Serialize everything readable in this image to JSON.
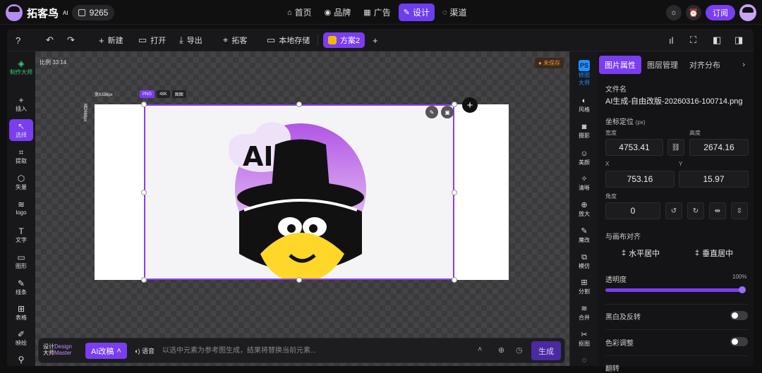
{
  "app": {
    "name": "拓客鸟",
    "name_suffix": "AI",
    "credits": "9265"
  },
  "nav": [
    {
      "label": "首页",
      "icon": "⌂"
    },
    {
      "label": "品牌",
      "icon": "◉"
    },
    {
      "label": "广告",
      "icon": "▦"
    },
    {
      "label": "设计",
      "icon": "✎"
    },
    {
      "label": "渠道",
      "icon": "◌"
    }
  ],
  "nav_active": "设计",
  "topright": {
    "subscribe_label": "订阅"
  },
  "toolbar": {
    "new_label": "新建",
    "open_label": "打开",
    "export_label": "导出",
    "tuoke_label": "拓客",
    "local_label": "本地存储",
    "tab_label": "方案2"
  },
  "leftbar": [
    {
      "label": "制作大师",
      "icon": "◈"
    },
    {
      "label": "插入",
      "icon": "+"
    },
    {
      "label": "选择",
      "icon": "↖"
    },
    {
      "label": "提取",
      "icon": "⌗"
    },
    {
      "label": "矢量",
      "icon": "⬡"
    },
    {
      "label": "logo",
      "icon": "≋"
    },
    {
      "label": "文字",
      "icon": "T"
    },
    {
      "label": "图形",
      "icon": "▭"
    },
    {
      "label": "线条",
      "icon": "✎"
    },
    {
      "label": "表格",
      "icon": "⊞"
    },
    {
      "label": "映绘",
      "icon": "✐"
    },
    {
      "label": "",
      "icon": "⚲"
    }
  ],
  "canvas": {
    "ratio_label": "比例 33:14",
    "unsaved_label": "● 未保存",
    "width_label": "宽6336px",
    "height_label": "高2688px",
    "tags": [
      "PNG",
      "48K",
      "图图"
    ]
  },
  "bottom": {
    "brand_line1": "设计",
    "brand_en1": "Design",
    "brand_line2": "大师",
    "brand_en2": "Master",
    "ai_button": "AI改稿",
    "voice_label": "语音",
    "prompt_placeholder": "以选中元素为参考图生成，结果将替换当前元素...",
    "generate_label": "生成"
  },
  "toolstrip": [
    {
      "label": "修图大师",
      "icon": "PS"
    },
    {
      "label": "风格",
      "icon": "◐"
    },
    {
      "label": "摄影",
      "icon": "◙"
    },
    {
      "label": "美颜",
      "icon": "☺"
    },
    {
      "label": "清晰",
      "icon": "✧"
    },
    {
      "label": "放大",
      "icon": "⊕"
    },
    {
      "label": "魔改",
      "icon": "✎"
    },
    {
      "label": "模仿",
      "icon": "⧉"
    },
    {
      "label": "分割",
      "icon": "⊞"
    },
    {
      "label": "合并",
      "icon": "≋"
    },
    {
      "label": "抠图",
      "icon": "✂"
    },
    {
      "label": "",
      "icon": "◌"
    }
  ],
  "panel": {
    "tabs": [
      "图片属性",
      "图层管理",
      "对齐分布"
    ],
    "more_icon": "›",
    "filename_label": "文件名",
    "filename": "AI生成-自由改版-20260316-100714.png",
    "coord_label": "坐标定位",
    "coord_unit": "(px)",
    "width_label": "宽度",
    "height_label": "高度",
    "width": "4753.41",
    "height": "2674.16",
    "x_label": "X",
    "y_label": "Y",
    "x": "753.16",
    "y": "15.97",
    "angle_label": "角度",
    "angle": "0",
    "align_label": "与画布对齐",
    "align_h": "水平居中",
    "align_v": "垂直居中",
    "opacity_label": "透明度",
    "opacity": 100,
    "opacity_text": "100%",
    "invert_label": "黑白及反转",
    "color_label": "色彩调整",
    "cut_label": "翻转"
  }
}
